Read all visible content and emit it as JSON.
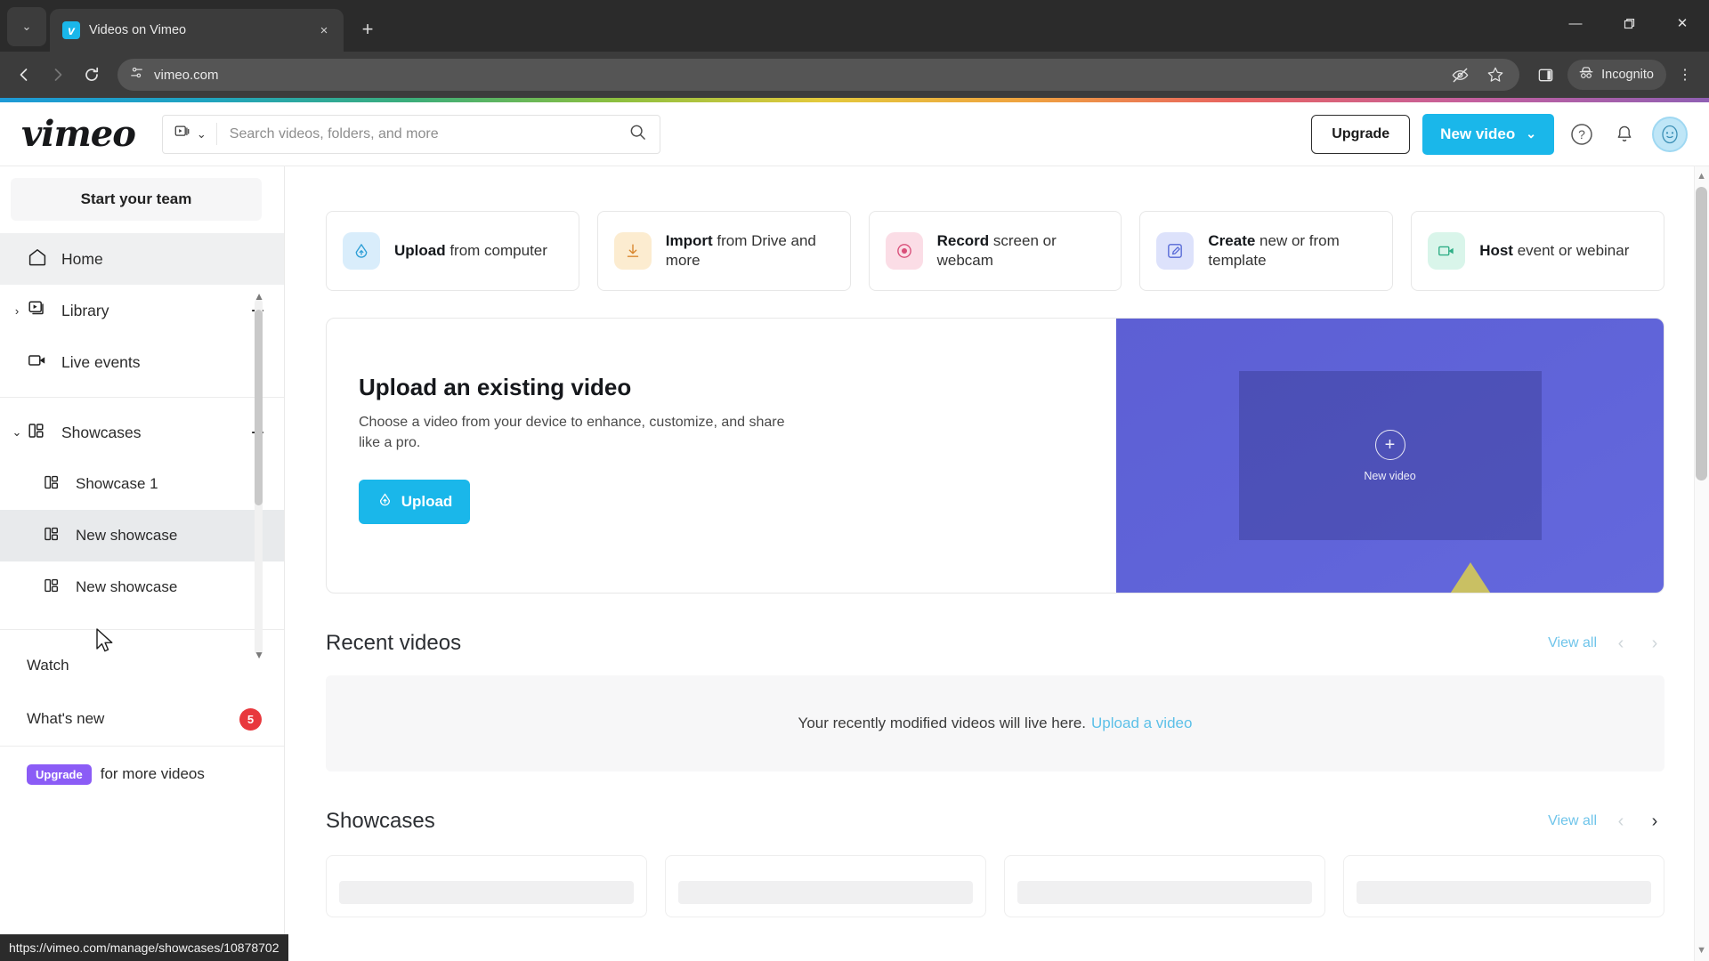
{
  "browser": {
    "tab": {
      "title": "Videos on Vimeo",
      "favicon": "vimeo-favicon",
      "close": "×"
    },
    "new_tab_label": "+",
    "tab_list_label": "⌄",
    "window": {
      "minimize": "—",
      "maximize": "❐",
      "close": "✕"
    },
    "nav": {
      "back": "←",
      "forward": "→",
      "reload": "⟳"
    },
    "omnibox": {
      "url": "vimeo.com",
      "site_info_icon": "page-settings-icon"
    },
    "actions": {
      "tracking_protection": "eye-off-icon",
      "bookmark": "star-icon",
      "side_panel": "split-panel-icon",
      "incognito_label": "Incognito",
      "menu": "⋮"
    }
  },
  "status_bar": {
    "url": "https://vimeo.com/manage/showcases/10878702"
  },
  "header": {
    "logo": "vimeo",
    "search": {
      "placeholder": "Search videos, folders, and more",
      "value": "",
      "type_icon": "video-filter-icon",
      "caret": "⌄",
      "search_icon": "search-icon"
    },
    "upgrade_label": "Upgrade",
    "new_video_label": "New video",
    "new_video_caret": "⌄",
    "help_icon": "?",
    "bell_icon": "notification-bell-icon",
    "avatar_icon": "user-avatar"
  },
  "sidebar": {
    "team_button": "Start your team",
    "items": [
      {
        "label": "Home",
        "icon": "home-icon",
        "state": "active"
      },
      {
        "label": "Library",
        "icon": "library-icon",
        "caret": "›",
        "plus": "+"
      },
      {
        "label": "Live events",
        "icon": "live-camera-icon"
      }
    ],
    "showcases": {
      "label": "Showcases",
      "icon": "showcase-icon",
      "caret": "⌄",
      "plus": "+",
      "children": [
        {
          "label": "Showcase 1",
          "icon": "showcase-icon"
        },
        {
          "label": "New showcase",
          "icon": "showcase-icon",
          "state": "hovered",
          "kebab": "⋮"
        },
        {
          "label": "New showcase",
          "icon": "showcase-icon"
        }
      ]
    },
    "bottom": [
      {
        "label": "Watch"
      },
      {
        "label": "What's new",
        "badge": "5"
      }
    ],
    "upgrade_promo": {
      "chip": "Upgrade",
      "text": "for more videos"
    },
    "scroll_down_arrow": "▼",
    "scroll_up_arrow": "▲"
  },
  "main": {
    "quick_cards": [
      {
        "bold": "Upload",
        "rest": " from computer",
        "icon": "cloud-upload-icon",
        "bg": "#d9edfb",
        "fg": "#2f9fd6"
      },
      {
        "bold": "Import",
        "rest": " from Drive and more",
        "icon": "download-arrow-icon",
        "bg": "#fcecd0",
        "fg": "#d9872f"
      },
      {
        "bold": "Record",
        "rest": " screen or webcam",
        "icon": "record-dot-icon",
        "bg": "#fbdde6",
        "fg": "#d94f79"
      },
      {
        "bold": "Create",
        "rest": " new or from template",
        "icon": "create-edit-icon",
        "bg": "#dde2fb",
        "fg": "#5568d6"
      },
      {
        "bold": "Host",
        "rest": " event or webinar",
        "icon": "webinar-camera-icon",
        "bg": "#d9f5ea",
        "fg": "#2fae86"
      }
    ],
    "hero": {
      "title": "Upload an existing video",
      "description": "Choose a video from your device to enhance, customize, and share like a pro.",
      "button": "Upload",
      "button_icon": "cloud-upload-icon",
      "art_plus": "+",
      "art_label": "New video"
    },
    "recent": {
      "title": "Recent videos",
      "view_all": "View all",
      "prev": "‹",
      "next": "›",
      "empty_text": "Your recently modified videos will live here.",
      "empty_link": "Upload a video"
    },
    "showcases_section": {
      "title": "Showcases",
      "view_all": "View all",
      "prev": "‹",
      "next": "›"
    }
  },
  "colors": {
    "vimeo_blue": "#1ab7ea",
    "badge_red": "#e8383d",
    "upgrade_purple": "#8b5cf6",
    "link_blue": "#6ec4ea"
  }
}
